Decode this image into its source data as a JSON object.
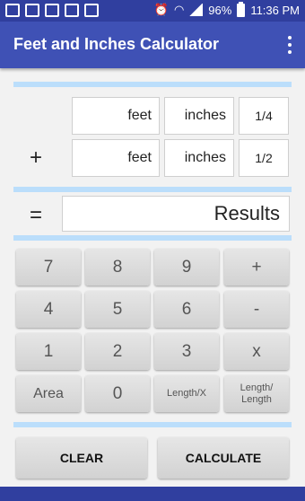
{
  "status_bar": {
    "battery": "96%",
    "time": "11:36 PM"
  },
  "app_bar": {
    "title": "Feet and Inches Calculator",
    "overflow_icon": "more-vert-icon"
  },
  "row1": {
    "feet": "feet",
    "inches": "inches",
    "fraction": "1/4"
  },
  "row2": {
    "operator": "+",
    "feet": "feet",
    "inches": "inches",
    "fraction": "1/2"
  },
  "result_row": {
    "equals": "=",
    "value": "Results"
  },
  "keypad": {
    "k7": "7",
    "k8": "8",
    "k9": "9",
    "plus": "+",
    "k4": "4",
    "k5": "5",
    "k6": "6",
    "minus": "-",
    "k1": "1",
    "k2": "2",
    "k3": "3",
    "times": "x",
    "area": "Area",
    "k0": "0",
    "len_x": "Length/X",
    "len_len": "Length/ Length"
  },
  "actions": {
    "clear": "CLEAR",
    "calculate": "CALCULATE"
  },
  "colors": {
    "app_bar": "#3f51b5",
    "status_bar": "#303f9f",
    "divider": "#bbdefb"
  }
}
